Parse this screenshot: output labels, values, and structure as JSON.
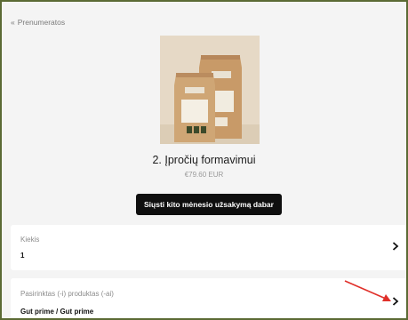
{
  "nav": {
    "back_chevron": "«",
    "back_label": "Prenumeratos"
  },
  "product": {
    "title": "2. Įpročių formavimui",
    "price": "€79.60 EUR",
    "image_icon": "coffee-bags-product-photo"
  },
  "actions": {
    "send_label": "Siųsti kito mėnesio užsakymą dabar"
  },
  "quantity": {
    "label": "Kiekis",
    "value": "1"
  },
  "selected_products": {
    "label": "Pasirinktas (-i) produktas (-ai)",
    "value": "Gut prime / Gut prime"
  },
  "colors": {
    "frame_border": "#5b6a34",
    "button_bg": "#0f0f0f",
    "annotation_arrow": "#e0302a",
    "background": "#f4f4f4"
  }
}
